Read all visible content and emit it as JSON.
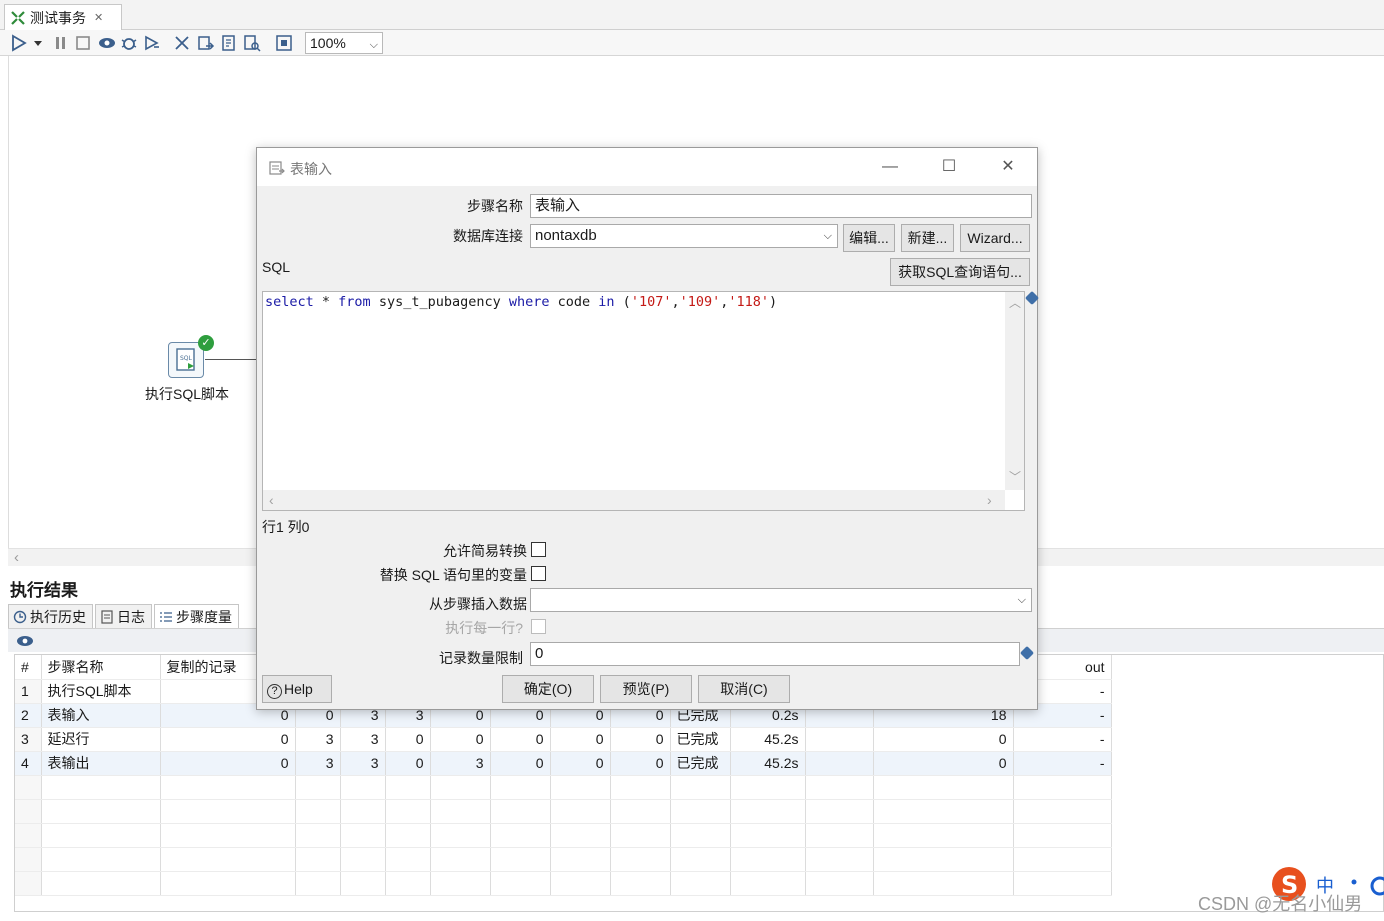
{
  "editor": {
    "tab_title": "测试事务",
    "zoom": "100%"
  },
  "canvas": {
    "step_label": "执行SQL脚本"
  },
  "results": {
    "title": "执行结果",
    "tabs": [
      "执行历史",
      "日志",
      "步骤度量"
    ],
    "columns": [
      "#",
      "步骤名称",
      "复制的记录"
    ],
    "out_column": "out",
    "rows": [
      {
        "n": "1",
        "name": "执行SQL脚本",
        "v1": "",
        "v2": "",
        "v3": "",
        "v4": "",
        "v5": "",
        "v6": "",
        "v7": "",
        "v8": "",
        "status": "",
        "time": "",
        "speed": "",
        "out": "-"
      },
      {
        "n": "2",
        "name": "表输入",
        "v1": "0",
        "v2": "0",
        "v3": "3",
        "v4": "3",
        "v5": "0",
        "v6": "0",
        "v7": "0",
        "v8": "0",
        "status": "已完成",
        "time": "0.2s",
        "speed": "18",
        "out": "-"
      },
      {
        "n": "3",
        "name": "延迟行",
        "v1": "0",
        "v2": "3",
        "v3": "3",
        "v4": "0",
        "v5": "0",
        "v6": "0",
        "v7": "0",
        "v8": "0",
        "status": "已完成",
        "time": "45.2s",
        "speed": "0",
        "out": "-"
      },
      {
        "n": "4",
        "name": "表输出",
        "v1": "0",
        "v2": "3",
        "v3": "3",
        "v4": "0",
        "v5": "3",
        "v6": "0",
        "v7": "0",
        "v8": "0",
        "status": "已完成",
        "time": "45.2s",
        "speed": "0",
        "out": "-"
      }
    ]
  },
  "dialog": {
    "title": "表输入",
    "step_name_label": "步骤名称",
    "step_name_value": "表输入",
    "db_conn_label": "数据库连接",
    "db_conn_value": "nontaxdb",
    "edit_button": "编辑...",
    "new_button": "新建...",
    "wizard_button": "Wizard...",
    "sql_label": "SQL",
    "get_sql_button": "获取SQL查询语句...",
    "sql": {
      "kw_select": "select",
      "star": " * ",
      "kw_from": "from",
      "table": " sys_t_pubagency ",
      "kw_where": "where",
      "col": " code ",
      "kw_in": "in",
      "open": " (",
      "s1": "'107'",
      "comma1": ",",
      "s2": "'109'",
      "comma2": ",",
      "s3": "'118'",
      "close": ")"
    },
    "cursor_pos": "行1 列0",
    "lazy_conversion_label": "允许简易转换",
    "replace_vars_label": "替换 SQL 语句里的变量",
    "insert_from_step_label": "从步骤插入数据",
    "insert_from_step_value": "",
    "execute_each_row_label": "执行每一行?",
    "limit_label": "记录数量限制",
    "limit_value": "0",
    "help_button": "Help",
    "ok_button": "确定(O)",
    "preview_button": "预览(P)",
    "cancel_button": "取消(C)"
  },
  "watermark": {
    "text": "CSDN @无名小仙男",
    "ime_label": "中"
  }
}
